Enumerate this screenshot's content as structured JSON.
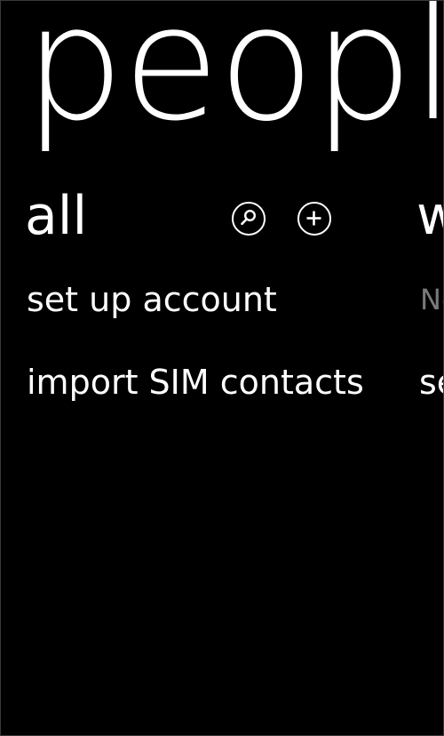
{
  "hub": {
    "title": "people"
  },
  "pivot": {
    "current": {
      "header": "all",
      "search_icon": "search-icon",
      "add_icon": "add-icon",
      "items": [
        {
          "label": "set up account"
        },
        {
          "label": "import SIM contacts"
        }
      ]
    },
    "next_peek": {
      "header": "w",
      "line1": "Nc",
      "line2": "se"
    }
  },
  "colors": {
    "background": "#000000",
    "foreground": "#ffffff",
    "muted": "#7a7a7a"
  }
}
